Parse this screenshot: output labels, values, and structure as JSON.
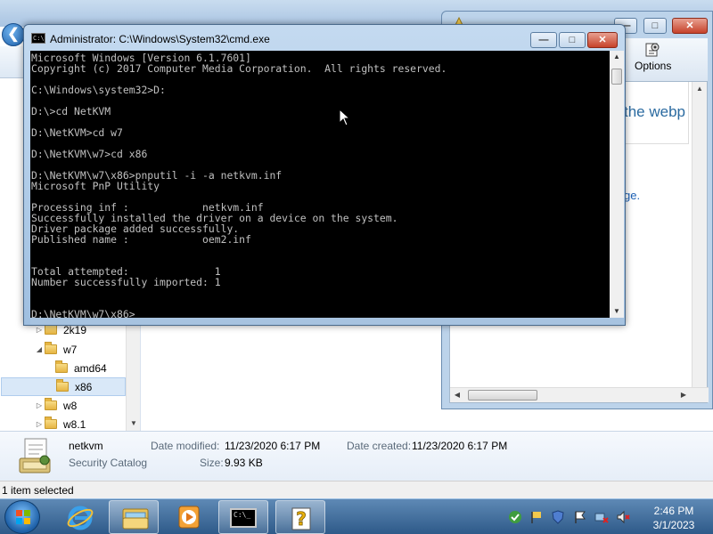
{
  "explorer": {
    "tree": [
      {
        "label": "2k19"
      },
      {
        "label": "w7"
      },
      {
        "label": "amd64"
      },
      {
        "label": "x86"
      },
      {
        "label": "w8"
      },
      {
        "label": "w8.1"
      }
    ],
    "details": {
      "file_name": "netkvm",
      "file_type": "Security Catalog",
      "modified_label": "Date modified:",
      "modified_value": "11/23/2020 6:17 PM",
      "created_label": "Date created:",
      "created_value": "11/23/2020 6:17 PM",
      "size_label": "Size:",
      "size_value": "9.93 KB"
    },
    "status": "1 item selected"
  },
  "help_window": {
    "options_label": "Options",
    "heading_fragment": "the webp",
    "link_fragment": "ge."
  },
  "cmd": {
    "title": "Administrator: C:\\Windows\\System32\\cmd.exe",
    "output": "Microsoft Windows [Version 6.1.7601]\nCopyright (c) 2017 Computer Media Corporation.  All rights reserved.\n\nC:\\Windows\\system32>D:\n\nD:\\>cd NetKVM\n\nD:\\NetKVM>cd w7\n\nD:\\NetKVM\\w7>cd x86\n\nD:\\NetKVM\\w7\\x86>pnputil -i -a netkvm.inf\nMicrosoft PnP Utility\n\nProcessing inf :            netkvm.inf\nSuccessfully installed the driver on a device on the system.\nDriver package added successfully.\nPublished name :            oem2.inf\n\n\nTotal attempted:              1\nNumber successfully imported: 1\n\n\nD:\\NetKVM\\w7\\x86>"
  },
  "taskbar": {
    "clock_time": "2:46 PM",
    "clock_date": "3/1/2023"
  },
  "colors": {
    "console_bg": "#000000",
    "console_text": "#c0c0c0",
    "taskbar": "#2e5a89",
    "close_button": "#c6422a"
  }
}
